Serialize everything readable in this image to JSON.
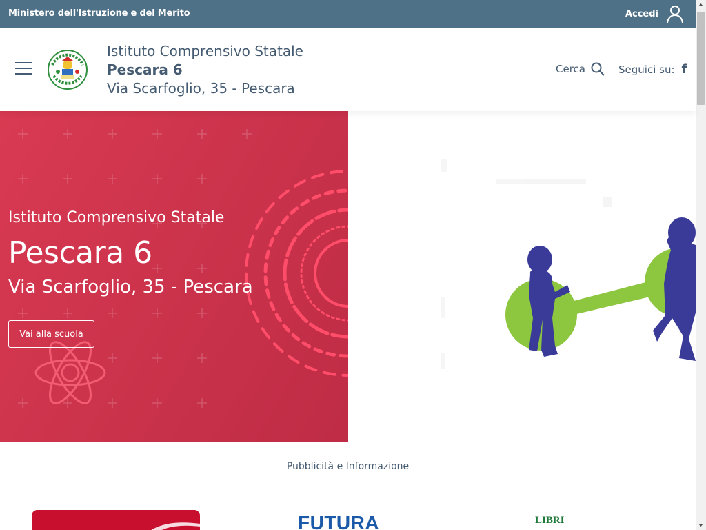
{
  "topbar": {
    "ministry": "Ministero dell'Istruzione e del Merito",
    "login_label": "Accedi",
    "login_icon": "user-icon",
    "bg_color": "#4f7188"
  },
  "header": {
    "menu_icon": "hamburger-icon",
    "logo_icon": "school-logo",
    "brand_line1": "Istituto Comprensivo Statale",
    "brand_line2": "Pescara 6",
    "brand_line3": "Via Scarfoglio, 35 - Pescara",
    "search_label": "Cerca",
    "search_icon": "search-icon",
    "social_label": "Seguici su:",
    "social_icon": "facebook-icon",
    "facebook_glyph": "f"
  },
  "hero": {
    "title_small": "Istituto Comprensivo Statale",
    "title_big": "Pescara 6",
    "subtitle": "Via Scarfoglio, 35 - Pescara",
    "button_label": "Vai alla scuola",
    "accent_color": "#d1344d"
  },
  "ads": {
    "title": "Pubblicità e Informazione",
    "items": [
      {
        "name": "red-banner",
        "text": ""
      },
      {
        "name": "futura",
        "text": "FUTURA"
      },
      {
        "name": "libri",
        "text": "LIBRI"
      }
    ]
  }
}
